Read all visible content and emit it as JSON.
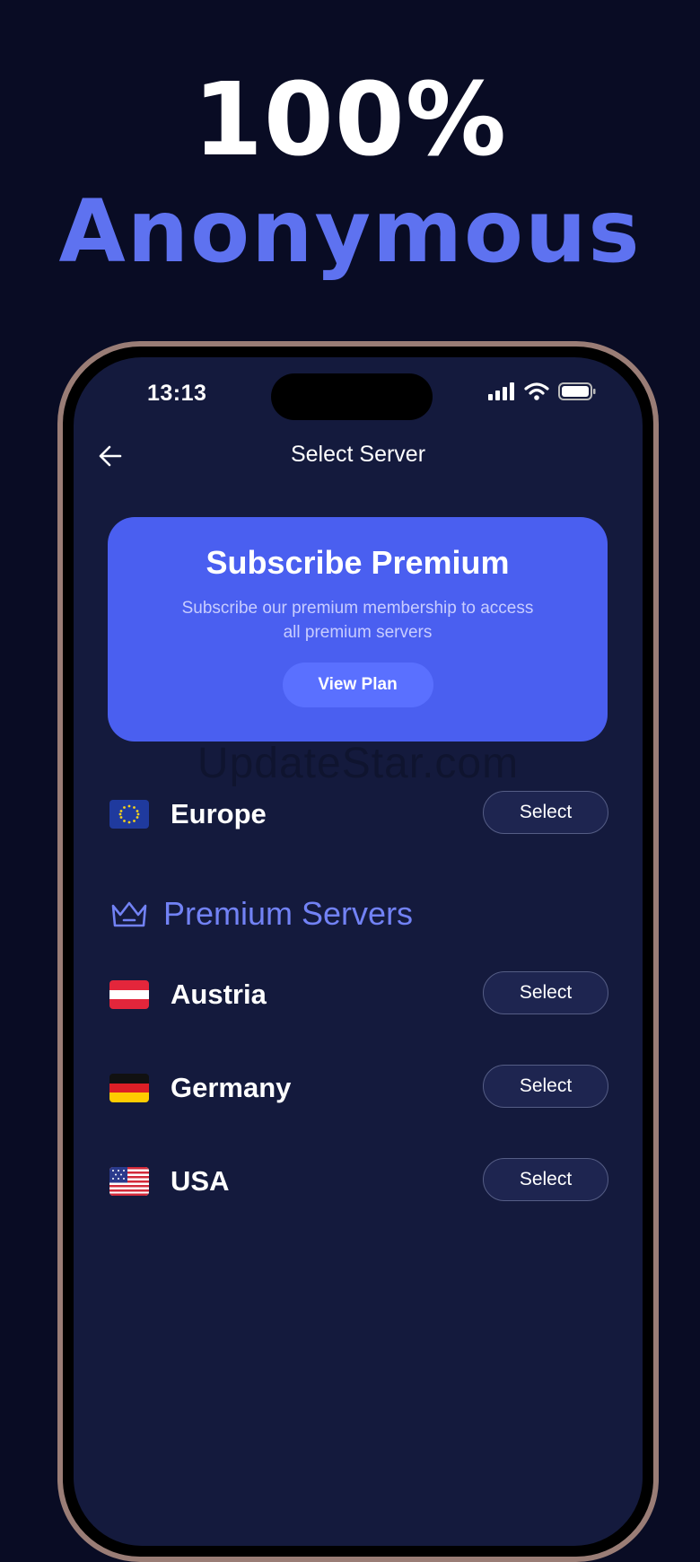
{
  "headline": {
    "line1": "100%",
    "line2": "Anonymous"
  },
  "status_bar": {
    "time": "13:13"
  },
  "nav": {
    "title": "Select Server"
  },
  "promo": {
    "title": "Subscribe Premium",
    "description": "Subscribe our premium membership to access all premium servers",
    "button_label": "View Plan"
  },
  "watermark": "UpdateStar.com",
  "free_servers": [
    {
      "name": "Europe",
      "button": "Select",
      "flag": "eu-flag"
    }
  ],
  "premium": {
    "heading": "Premium Servers",
    "icon": "crown-icon"
  },
  "premium_servers": [
    {
      "name": "Austria",
      "button": "Select",
      "flag": "austria-flag"
    },
    {
      "name": "Germany",
      "button": "Select",
      "flag": "germany-flag"
    },
    {
      "name": "USA",
      "button": "Select",
      "flag": "usa-flag"
    }
  ],
  "colors": {
    "background": "#090c24",
    "screen": "#141a3d",
    "accent": "#5e72f0",
    "promo_card": "#4a5ff0",
    "frame": "#9a7d76"
  }
}
